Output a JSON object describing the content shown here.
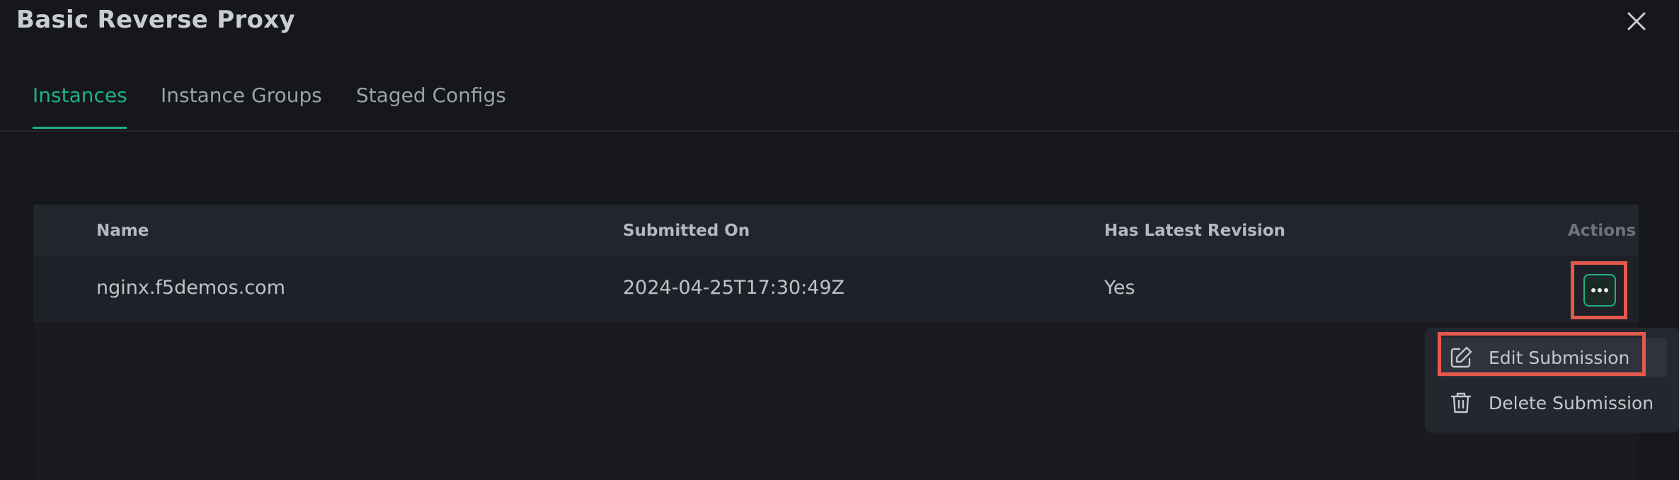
{
  "dialog": {
    "title": "Basic Reverse Proxy",
    "close_icon": "close-icon"
  },
  "tabs": [
    {
      "label": "Instances",
      "active": true
    },
    {
      "label": "Instance Groups",
      "active": false
    },
    {
      "label": "Staged Configs",
      "active": false
    }
  ],
  "table": {
    "columns": [
      "Name",
      "Submitted On",
      "Has Latest Revision",
      "Actions"
    ],
    "rows": [
      {
        "name": "nginx.f5demos.com",
        "submitted_on": "2024-04-25T17:30:49Z",
        "has_latest_revision": "Yes",
        "actions_icon": "more-horizontal-icon"
      }
    ]
  },
  "actions_menu": {
    "items": [
      {
        "label": "Edit Submission",
        "icon": "edit-icon",
        "highlighted": true
      },
      {
        "label": "Delete Submission",
        "icon": "trash-icon",
        "highlighted": false
      }
    ]
  },
  "colors": {
    "accent": "#1fb184",
    "highlight_box": "#e5594d",
    "background": "#15171d"
  }
}
